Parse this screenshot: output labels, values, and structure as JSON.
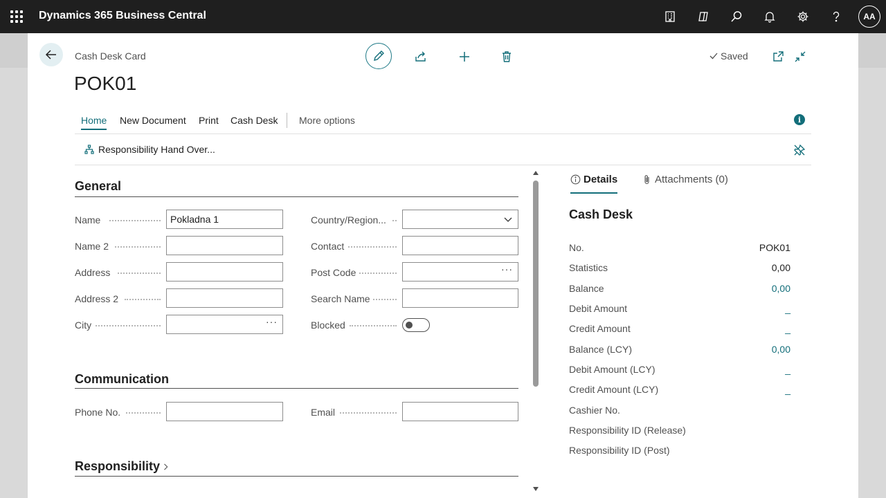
{
  "app": {
    "title": "Dynamics 365 Business Central",
    "user_initials": "AA"
  },
  "topbar_icons": [
    "document-icon",
    "copilot-icon",
    "search-icon",
    "bell-icon",
    "gear-icon",
    "help-icon"
  ],
  "card": {
    "caption": "Cash Desk Card",
    "title": "POK01",
    "status": "Saved"
  },
  "actions": {
    "tabs": [
      "Home",
      "New Document",
      "Print",
      "Cash Desk"
    ],
    "more": "More options",
    "promoted": "Responsibility Hand Over..."
  },
  "general": {
    "title": "General",
    "left_fields": [
      {
        "label": "Name",
        "value": "Pokladna 1"
      },
      {
        "label": "Name 2",
        "value": ""
      },
      {
        "label": "Address",
        "value": ""
      },
      {
        "label": "Address 2",
        "value": ""
      },
      {
        "label": "City",
        "value": ""
      }
    ],
    "right_fields": [
      {
        "label": "Country/Region...",
        "value": ""
      },
      {
        "label": "Contact",
        "value": ""
      },
      {
        "label": "Post Code",
        "value": ""
      },
      {
        "label": "Search Name",
        "value": ""
      },
      {
        "label": "Blocked",
        "value": ""
      }
    ],
    "blocked": false
  },
  "communication": {
    "title": "Communication",
    "phone_label": "Phone No.",
    "phone_value": "",
    "email_label": "Email",
    "email_value": ""
  },
  "responsibility": {
    "title": "Responsibility"
  },
  "factbox": {
    "tabs": [
      "Details",
      "Attachments (0)"
    ],
    "heading": "Cash Desk",
    "rows": [
      {
        "label": "No.",
        "value": "POK01"
      },
      {
        "label": "Statistics",
        "value": "0,00"
      },
      {
        "label": "Balance",
        "value": "0,00"
      },
      {
        "label": "Debit Amount",
        "value": "_"
      },
      {
        "label": "Credit Amount",
        "value": "_"
      },
      {
        "label": "Balance (LCY)",
        "value": "0,00"
      },
      {
        "label": "Debit Amount (LCY)",
        "value": "_"
      },
      {
        "label": "Credit Amount (LCY)",
        "value": "_"
      },
      {
        "label": "Cashier No.",
        "value": ""
      },
      {
        "label": "Responsibility ID (Release)",
        "value": ""
      },
      {
        "label": "Responsibility ID (Post)",
        "value": ""
      }
    ]
  },
  "colors": {
    "accent": "#136e7a",
    "topbar": "#1f1f1f"
  }
}
